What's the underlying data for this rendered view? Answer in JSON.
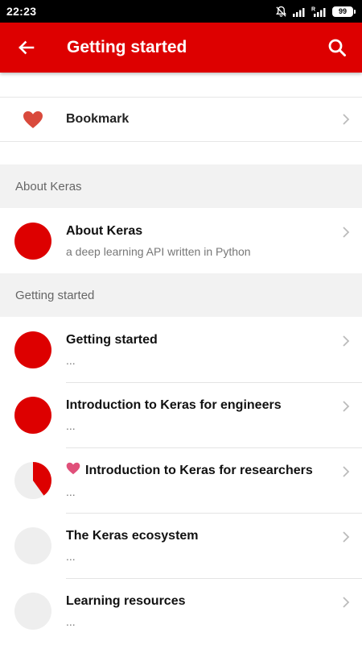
{
  "status_bar": {
    "time": "22:23",
    "battery": "99"
  },
  "app_bar": {
    "title": "Getting started"
  },
  "bookmark": {
    "label": "Bookmark"
  },
  "sections": [
    {
      "header": "About Keras",
      "items": [
        {
          "title": "About Keras",
          "subtitle": "a deep learning API written in Python",
          "progress": 1.0,
          "bookmarked": false
        }
      ]
    },
    {
      "header": "Getting started",
      "items": [
        {
          "title": "Getting started",
          "subtitle": "...",
          "progress": 1.0,
          "bookmarked": false
        },
        {
          "title": "Introduction to Keras for engineers",
          "subtitle": "...",
          "progress": 1.0,
          "bookmarked": false
        },
        {
          "title": "Introduction to Keras for researchers",
          "subtitle": "...",
          "progress": 0.4,
          "bookmarked": true
        },
        {
          "title": "The Keras ecosystem",
          "subtitle": "...",
          "progress": 0.0,
          "bookmarked": false
        },
        {
          "title": "Learning resources",
          "subtitle": "...",
          "progress": 0.0,
          "bookmarked": false
        }
      ]
    }
  ],
  "colors": {
    "primary": "#dd0000",
    "progress_empty": "#eeeeee",
    "bookmark_heart": "#d94a3c",
    "item_heart": "#e0507a"
  },
  "icons": {
    "back": "arrow-left-icon",
    "search": "search-icon",
    "bookmark": "heart-icon",
    "chevron": "chevron-right-icon"
  }
}
